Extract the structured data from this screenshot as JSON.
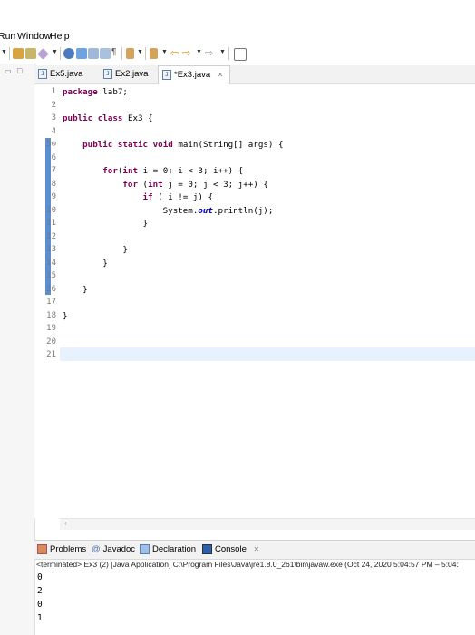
{
  "menu": {
    "items": [
      "Run",
      "Window",
      "Help"
    ]
  },
  "editor_tabs": [
    {
      "label": "Ex5.java",
      "active": false
    },
    {
      "label": "Ex2.java",
      "active": false
    },
    {
      "label": "*Ex3.java",
      "active": true
    }
  ],
  "code_lines": [
    {
      "num": "1",
      "text": "package lab7;"
    },
    {
      "num": "2",
      "text": ""
    },
    {
      "num": "3",
      "text": "public class Ex3 {"
    },
    {
      "num": "4",
      "text": ""
    },
    {
      "num": "5⊖",
      "text": "    public static void main(String[] args) {"
    },
    {
      "num": "6",
      "text": ""
    },
    {
      "num": "7",
      "text": "        for(int i = 0; i < 3; i++) {"
    },
    {
      "num": "8",
      "text": "            for (int j = 0; j < 3; j++) {"
    },
    {
      "num": "9",
      "text": "                if ( i != j) {"
    },
    {
      "num": "10",
      "text": "                    System.out.println(j);"
    },
    {
      "num": "11",
      "text": "                }"
    },
    {
      "num": "12",
      "text": ""
    },
    {
      "num": "13",
      "text": "            }"
    },
    {
      "num": "14",
      "text": "        }"
    },
    {
      "num": "15",
      "text": ""
    },
    {
      "num": "16",
      "text": "    }"
    },
    {
      "num": "17",
      "text": ""
    },
    {
      "num": "18",
      "text": "}"
    },
    {
      "num": "19",
      "text": ""
    },
    {
      "num": "20",
      "text": ""
    },
    {
      "num": "21",
      "text": ""
    }
  ],
  "view_tabs": {
    "problems": "Problems",
    "javadoc": "Javadoc",
    "declaration": "Declaration",
    "console": "Console",
    "at_sign": "@"
  },
  "console": {
    "header": "<terminated> Ex3 (2) [Java Application] C:\\Program Files\\Java\\jre1.8.0_261\\bin\\javaw.exe  (Oct 24, 2020 5:04:57 PM – 5:04:",
    "output": [
      "0",
      "2",
      "0",
      "1"
    ]
  },
  "colors": {
    "keyword": "#7f0055",
    "field": "#0000c0",
    "change_bar": "#5b8fd1",
    "current_line": "#e8f2fe"
  },
  "icons": [
    "run-icon",
    "debug-icon",
    "new-java-project-icon",
    "search-icon",
    "back-arrow-icon",
    "forward-arrow-icon",
    "pin-icon"
  ]
}
